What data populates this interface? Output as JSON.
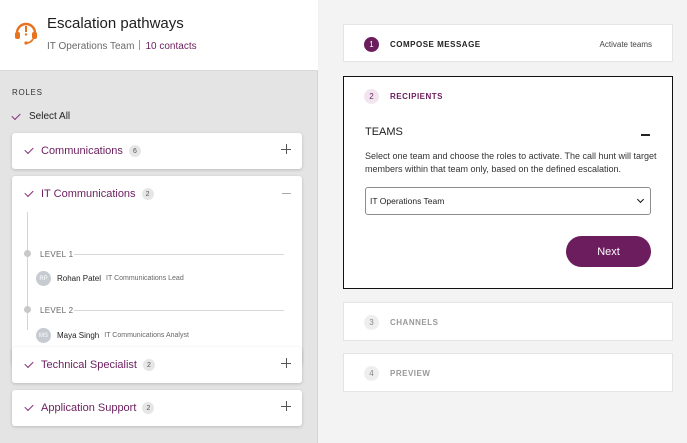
{
  "header": {
    "title": "Escalation pathways",
    "team": "IT Operations Team",
    "contacts": "10 contacts"
  },
  "roles": {
    "label": "ROLES",
    "select_all": "Select All",
    "cards": [
      {
        "name": "Communications",
        "count": "6"
      },
      {
        "name": "IT Communications",
        "count": "2",
        "levels": [
          {
            "label": "LEVEL 1",
            "person": {
              "initials": "RP",
              "name": "Rohan Patel",
              "role": "IT Communications Lead"
            }
          },
          {
            "label": "LEVEL 2",
            "person": {
              "initials": "MS",
              "name": "Maya Singh",
              "role": "IT Communications Analyst"
            }
          }
        ]
      },
      {
        "name": "Technical Specialist",
        "count": "2"
      },
      {
        "name": "Application Support",
        "count": "2"
      }
    ]
  },
  "steps": {
    "compose": {
      "num": "1",
      "title": "COMPOSE MESSAGE",
      "right": "Activate teams"
    },
    "recipients": {
      "num": "2",
      "title": "RECIPIENTS",
      "section": "TEAMS",
      "description": "Select one team and choose the roles to activate. The call hunt will target members within that team only, based on the defined escalation.",
      "selected_team": "IT Operations Team",
      "next_label": "Next"
    },
    "channels": {
      "num": "3",
      "title": "CHANNELS"
    },
    "preview": {
      "num": "4",
      "title": "PREVIEW"
    }
  },
  "colors": {
    "accent": "#6b1d5e",
    "logo": "#e8731e"
  },
  "icons": {
    "logo": "headset-alert-icon",
    "check": "checkmark-icon",
    "expand": "plus-icon",
    "collapse": "minus-icon",
    "dropdown": "chevron-down-icon"
  }
}
